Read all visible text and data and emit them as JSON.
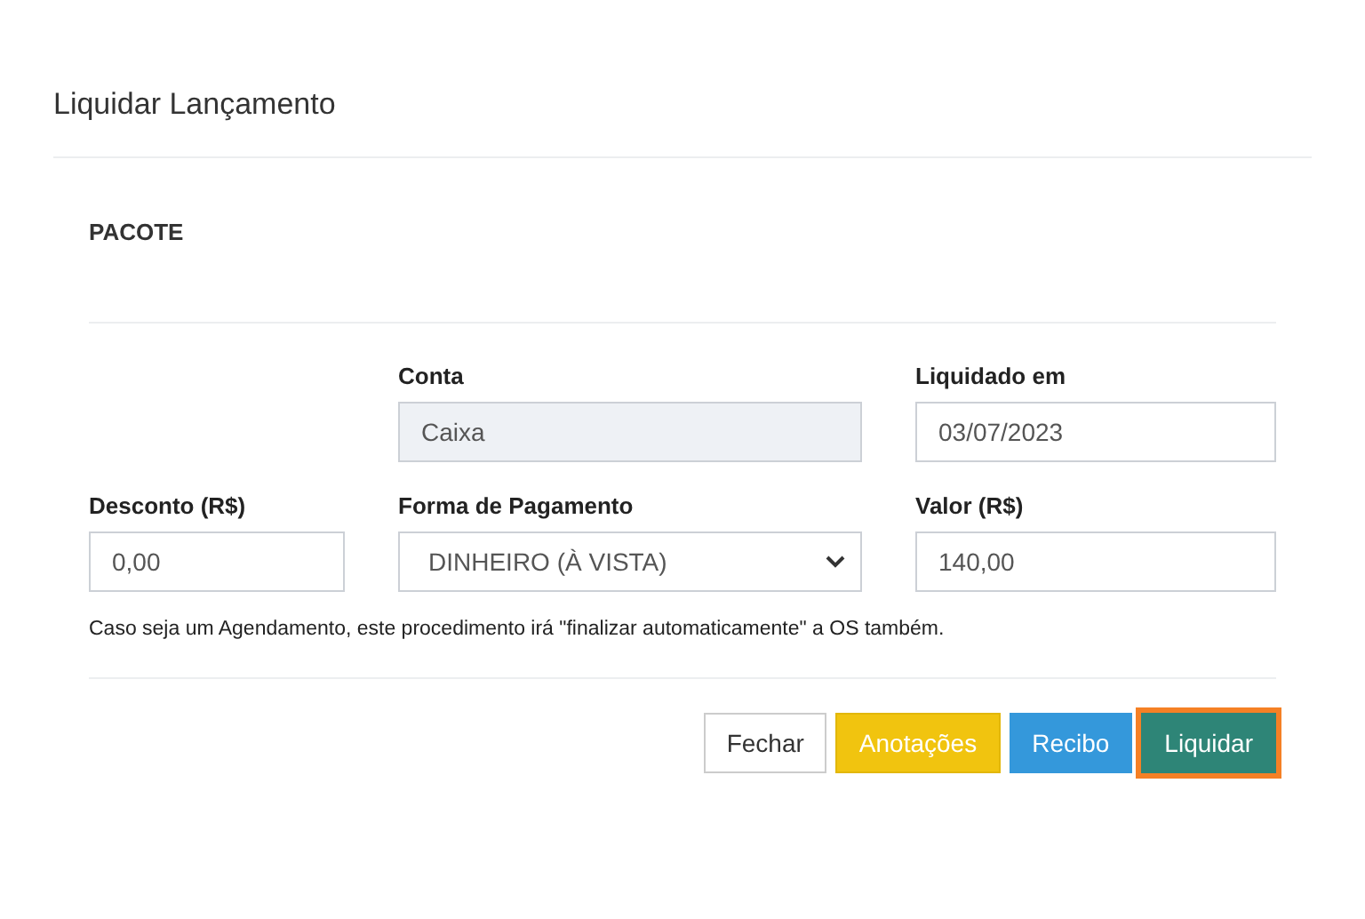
{
  "modal": {
    "title": "Liquidar Lançamento"
  },
  "section": {
    "heading": "PACOTE"
  },
  "field_rows": [
    [
      {
        "label": "Conta",
        "value": "Caixa",
        "kind": "input",
        "disabled": true
      },
      {
        "label": "Liquidado em",
        "value": "03/07/2023",
        "kind": "input",
        "disabled": false
      }
    ],
    [
      {
        "label": "Desconto (R$)",
        "value": "0,00",
        "kind": "input",
        "disabled": false
      },
      {
        "label": "Forma de Pagamento",
        "value": "DINHEIRO (À VISTA)",
        "kind": "select",
        "disabled": false
      },
      {
        "label": "Valor (R$)",
        "value": "140,00",
        "kind": "input",
        "disabled": false
      }
    ]
  ],
  "note": "Caso seja um Agendamento, este procedimento irá \"finalizar automaticamente\" a OS também.",
  "buttons": [
    {
      "label": "Fechar",
      "kind": "default",
      "focused": false
    },
    {
      "label": "Anotações",
      "kind": "warning",
      "focused": false
    },
    {
      "label": "Recibo",
      "kind": "info",
      "focused": false
    },
    {
      "label": "Liquidar",
      "kind": "success",
      "focused": true
    }
  ]
}
